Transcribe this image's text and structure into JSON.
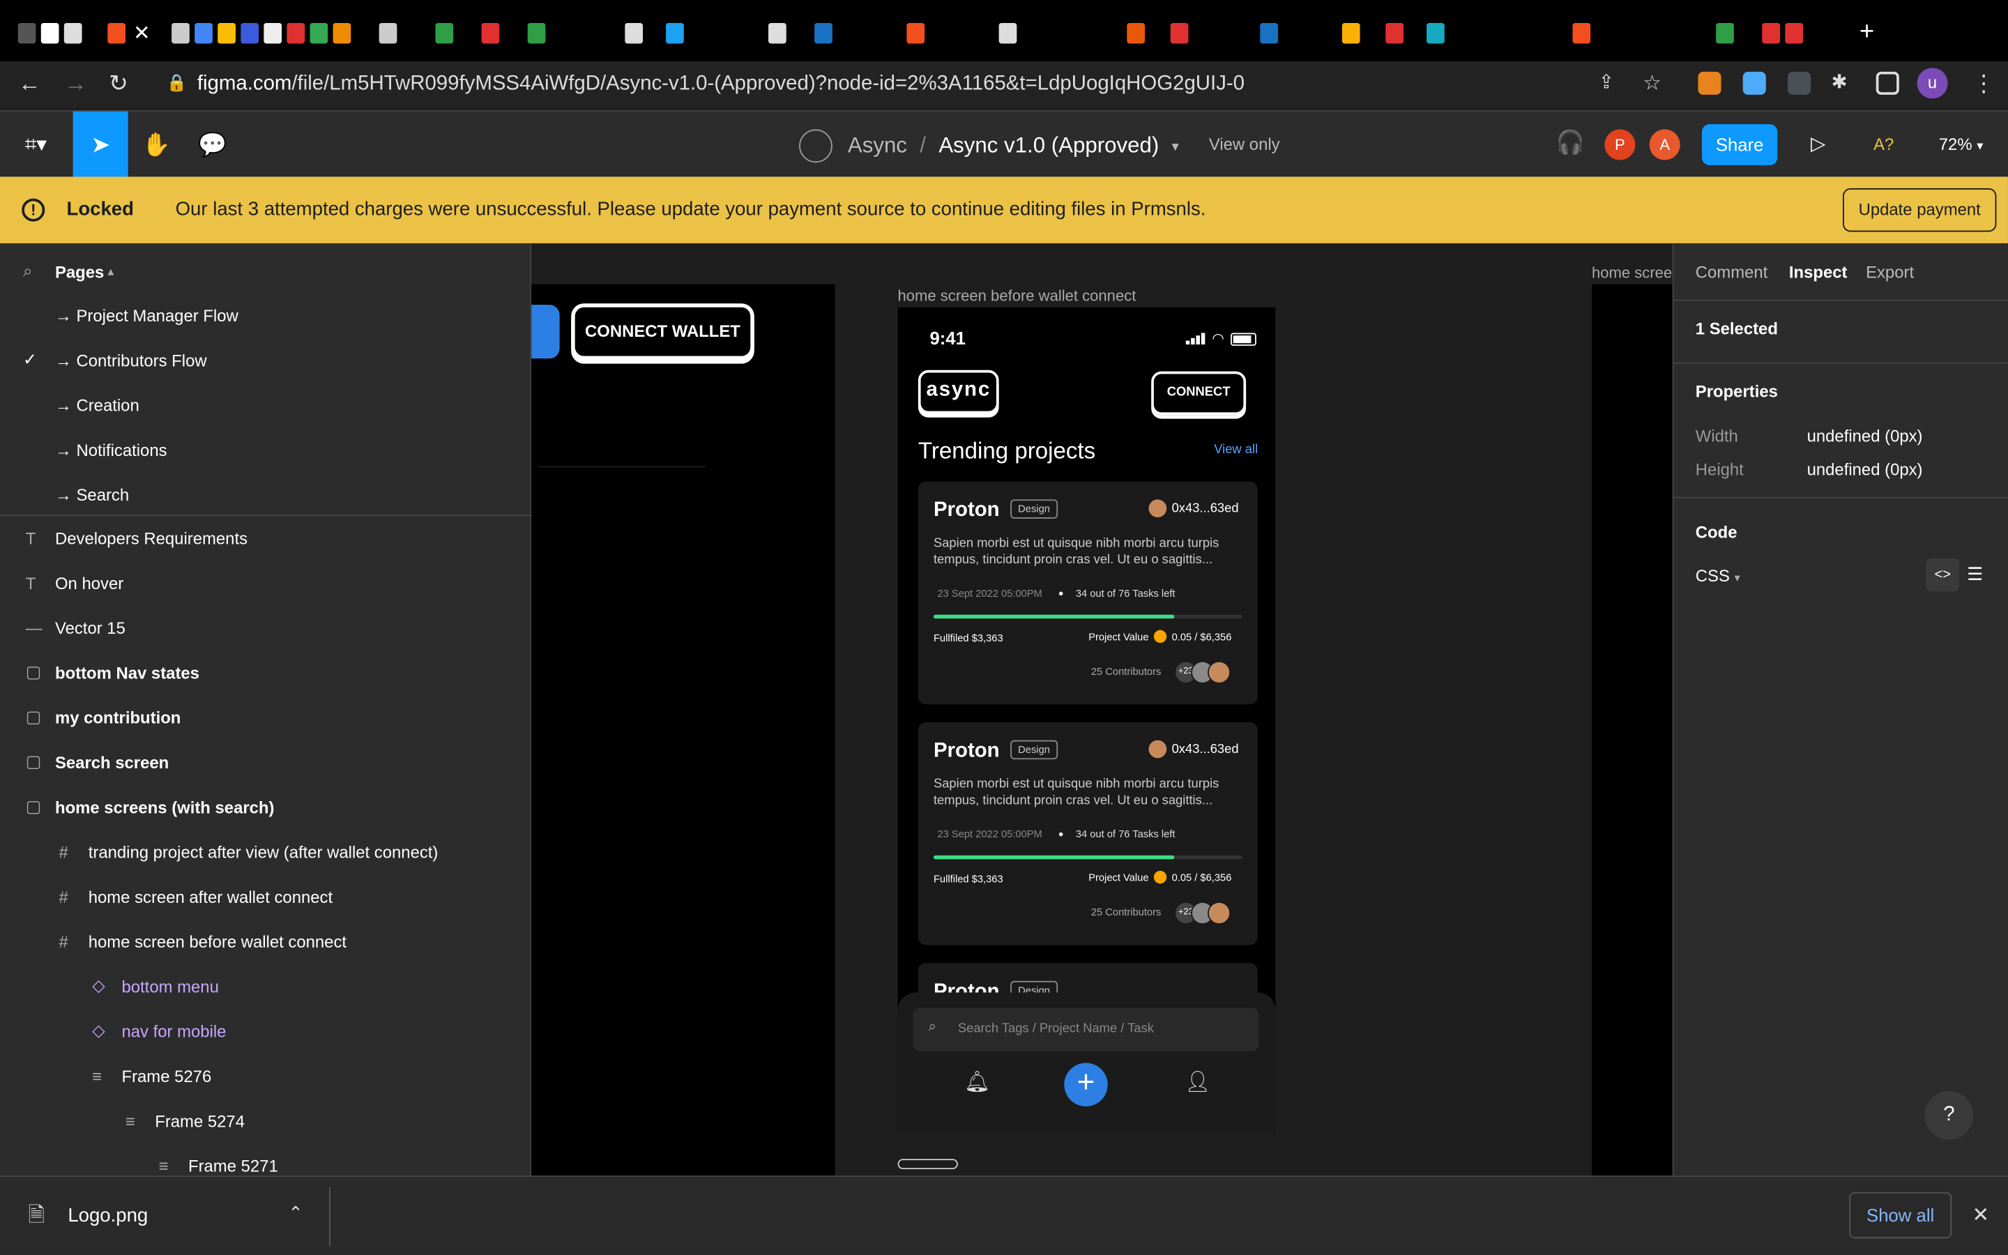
{
  "browser": {
    "url_domain": "figma.com",
    "url_path": "/file/Lm5HTwR099fyMSS4AiWfgD/Async-v1.0-(Approved)?node-id=2%3A1165&t=LdpUogIqHOG2gUIJ-0",
    "profile_initial": "u"
  },
  "toolbar": {
    "team": "Async",
    "file": "Async v1.0 (Approved)",
    "view_only": "View only",
    "avatar_p": "P",
    "avatar_a": "A",
    "share": "Share",
    "help": "A?",
    "zoom": "72%"
  },
  "banner": {
    "status": "Locked",
    "message": "Our last 3 attempted charges were unsuccessful. Please update your payment source to continue editing files in Prmsnls.",
    "button": "Update payment"
  },
  "layers": {
    "pages_header": "Pages",
    "pages": [
      {
        "label": "→ Project Manager Flow",
        "checked": false
      },
      {
        "label": "→ Contributors Flow",
        "checked": true
      },
      {
        "label": "→ Creation",
        "checked": false
      },
      {
        "label": "→ Notifications",
        "checked": false
      },
      {
        "label": "→ Search",
        "checked": false
      }
    ],
    "items": [
      {
        "label": "Developers Requirements",
        "icon": "text-icon"
      },
      {
        "label": "On hover",
        "icon": "text-icon"
      },
      {
        "label": "Vector 15",
        "icon": "line-icon"
      },
      {
        "label": "bottom Nav states",
        "icon": "section-icon"
      },
      {
        "label": "my contribution",
        "icon": "section-icon"
      },
      {
        "label": "Search screen",
        "icon": "section-icon"
      },
      {
        "label": "home screens (with search)",
        "icon": "section-icon"
      },
      {
        "label": "tranding project after view (after wallet connect)",
        "icon": "frame-icon"
      },
      {
        "label": "home screen after wallet connect",
        "icon": "frame-icon"
      },
      {
        "label": "home screen before wallet connect",
        "icon": "frame-icon"
      },
      {
        "label": "bottom menu",
        "icon": "component-icon"
      },
      {
        "label": "nav for mobile",
        "icon": "component-icon"
      },
      {
        "label": "Frame 5276",
        "icon": "autolayout-icon"
      },
      {
        "label": "Frame 5274",
        "icon": "autolayout-icon"
      },
      {
        "label": "Frame 5271",
        "icon": "autolayout-icon"
      }
    ]
  },
  "canvas": {
    "connect_wallet": "CONNECT WALLET",
    "frame_label": "home screen before wallet connect",
    "frame_label_right": "home scree",
    "phone": {
      "time": "9:41",
      "logo": "async",
      "connect": "CONNECT",
      "trending": "Trending projects",
      "view_all": "View all",
      "cards": [
        {
          "title": "Proton",
          "tag": "Design",
          "owner": "0x43...63ed",
          "desc": "Sapien morbi est ut quisque nibh morbi arcu turpis tempus,  tincidunt proin cras vel. Ut eu o sagittis...",
          "date": "23 Sept 2022 05:00PM",
          "tasks": "34 out of 76 Tasks left",
          "progress": 0.78,
          "fulfilled": "Fullfiled $3,363",
          "project_value_label": "Project Value",
          "project_value": "0.05  / $6,356",
          "contributors": "25 Contributors",
          "more": "+23"
        },
        {
          "title": "Proton",
          "tag": "Design",
          "owner": "0x43...63ed",
          "desc": "Sapien morbi est ut quisque nibh morbi arcu turpis tempus,  tincidunt proin cras vel. Ut eu o sagittis...",
          "date": "23 Sept 2022 05:00PM",
          "tasks": "34 out of 76 Tasks left",
          "progress": 0.78,
          "fulfilled": "Fullfiled $3,363",
          "project_value_label": "Project Value",
          "project_value": "0.05  / $6,356",
          "contributors": "25 Contributors",
          "more": "+23"
        }
      ],
      "search_placeholder": "Search Tags / Project Name / Task"
    }
  },
  "inspect": {
    "tabs": [
      "Comment",
      "Inspect",
      "Export"
    ],
    "active_tab": "Inspect",
    "selected": "1 Selected",
    "properties_header": "Properties",
    "width_label": "Width",
    "width_value": "undefined (0px)",
    "height_label": "Height",
    "height_value": "undefined (0px)",
    "code_header": "Code",
    "code_lang": "CSS"
  },
  "downloads": {
    "file": "Logo.png",
    "show_all": "Show all"
  },
  "colors": {
    "accent": "#0d99ff",
    "banner": "#ebc246",
    "progress": "#3ddc84",
    "component": "#c7a6ff"
  }
}
